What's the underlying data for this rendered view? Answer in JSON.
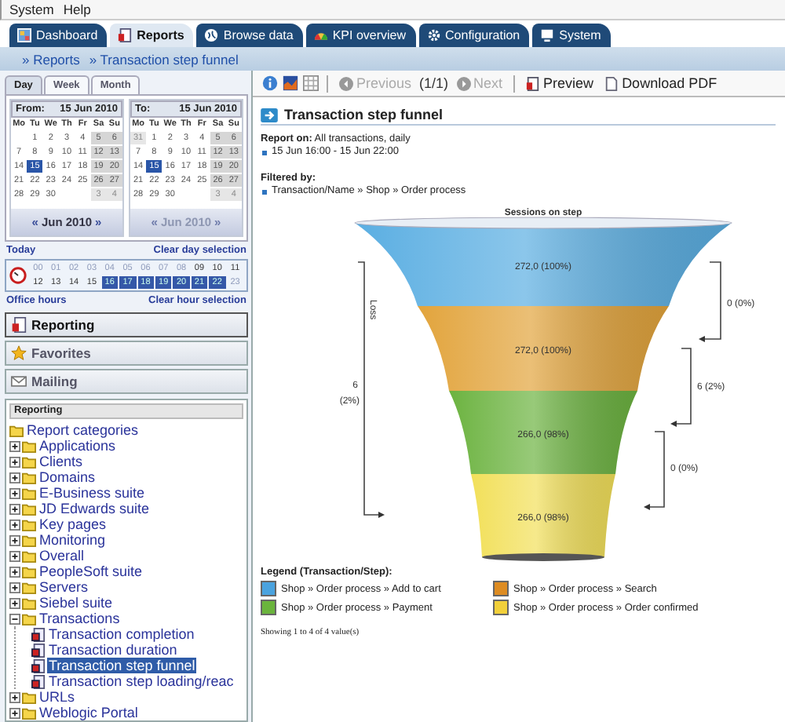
{
  "menu": [
    "System",
    "Help"
  ],
  "tabs": [
    {
      "label": "Dashboard",
      "selected": false
    },
    {
      "label": "Reports",
      "selected": true
    },
    {
      "label": "Browse data",
      "selected": false
    },
    {
      "label": "KPI overview",
      "selected": false
    },
    {
      "label": "Configuration",
      "selected": false
    },
    {
      "label": "System",
      "selected": false
    }
  ],
  "breadcrumb": [
    "» Reports",
    "» Transaction step funnel"
  ],
  "period_tabs": [
    {
      "label": "Day",
      "selected": true
    },
    {
      "label": "Week",
      "selected": false
    },
    {
      "label": "Month",
      "selected": false
    }
  ],
  "calendars": [
    {
      "label": "From:",
      "date": "15 Jun 2010",
      "weekdays": [
        "Mo",
        "Tu",
        "We",
        "Th",
        "Fr",
        "Sa",
        "Su"
      ],
      "nav_prev": "«",
      "nav_label": "Jun 2010",
      "nav_next": "»",
      "nav_disabled": false,
      "weeks": [
        [
          {
            "kind": "blank"
          },
          {
            "label": "1",
            "kind": "day",
            "selected": false
          },
          {
            "label": "2",
            "kind": "day",
            "selected": false
          },
          {
            "label": "3",
            "kind": "day",
            "selected": false
          },
          {
            "label": "4",
            "kind": "day",
            "selected": false
          },
          {
            "label": "5",
            "kind": "weekend",
            "selected": false
          },
          {
            "label": "6",
            "kind": "weekend",
            "selected": false
          }
        ],
        [
          {
            "label": "7",
            "kind": "day",
            "selected": false
          },
          {
            "label": "8",
            "kind": "day",
            "selected": false
          },
          {
            "label": "9",
            "kind": "day",
            "selected": false
          },
          {
            "label": "10",
            "kind": "day",
            "selected": false
          },
          {
            "label": "11",
            "kind": "day",
            "selected": false
          },
          {
            "label": "12",
            "kind": "weekend",
            "selected": false
          },
          {
            "label": "13",
            "kind": "weekend",
            "selected": false
          }
        ],
        [
          {
            "label": "14",
            "kind": "day",
            "selected": false
          },
          {
            "label": "15",
            "kind": "day",
            "selected": true
          },
          {
            "label": "16",
            "kind": "day",
            "selected": false
          },
          {
            "label": "17",
            "kind": "day",
            "selected": false
          },
          {
            "label": "18",
            "kind": "day",
            "selected": false
          },
          {
            "label": "19",
            "kind": "weekend",
            "selected": false
          },
          {
            "label": "20",
            "kind": "weekend",
            "selected": false
          }
        ],
        [
          {
            "label": "21",
            "kind": "day",
            "selected": false
          },
          {
            "label": "22",
            "kind": "day",
            "selected": false
          },
          {
            "label": "23",
            "kind": "day",
            "selected": false
          },
          {
            "label": "24",
            "kind": "day",
            "selected": false
          },
          {
            "label": "25",
            "kind": "day",
            "selected": false
          },
          {
            "label": "26",
            "kind": "weekend",
            "selected": false
          },
          {
            "label": "27",
            "kind": "weekend",
            "selected": false
          }
        ],
        [
          {
            "label": "28",
            "kind": "day",
            "selected": false
          },
          {
            "label": "29",
            "kind": "day",
            "selected": false
          },
          {
            "label": "30",
            "kind": "day",
            "selected": false
          },
          {
            "kind": "blank"
          },
          {
            "kind": "blank"
          },
          {
            "label": "3",
            "kind": "other",
            "selected": false
          },
          {
            "label": "4",
            "kind": "other",
            "selected": false
          }
        ]
      ]
    },
    {
      "label": "To:",
      "date": "15 Jun 2010",
      "weekdays": [
        "Mo",
        "Tu",
        "We",
        "Th",
        "Fr",
        "Sa",
        "Su"
      ],
      "nav_prev": "«",
      "nav_label": "Jun 2010",
      "nav_next": "»",
      "nav_disabled": true,
      "weeks": [
        [
          {
            "label": "31",
            "kind": "other",
            "selected": false
          },
          {
            "label": "1",
            "kind": "day",
            "selected": false
          },
          {
            "label": "2",
            "kind": "day",
            "selected": false
          },
          {
            "label": "3",
            "kind": "day",
            "selected": false
          },
          {
            "label": "4",
            "kind": "day",
            "selected": false
          },
          {
            "label": "5",
            "kind": "weekend",
            "selected": false
          },
          {
            "label": "6",
            "kind": "weekend",
            "selected": false
          }
        ],
        [
          {
            "label": "7",
            "kind": "day",
            "selected": false
          },
          {
            "label": "8",
            "kind": "day",
            "selected": false
          },
          {
            "label": "9",
            "kind": "day",
            "selected": false
          },
          {
            "label": "10",
            "kind": "day",
            "selected": false
          },
          {
            "label": "11",
            "kind": "day",
            "selected": false
          },
          {
            "label": "12",
            "kind": "weekend",
            "selected": false
          },
          {
            "label": "13",
            "kind": "weekend",
            "selected": false
          }
        ],
        [
          {
            "label": "14",
            "kind": "day",
            "selected": false
          },
          {
            "label": "15",
            "kind": "day",
            "selected": true
          },
          {
            "label": "16",
            "kind": "day",
            "selected": false
          },
          {
            "label": "17",
            "kind": "day",
            "selected": false
          },
          {
            "label": "18",
            "kind": "day",
            "selected": false
          },
          {
            "label": "19",
            "kind": "weekend",
            "selected": false
          },
          {
            "label": "20",
            "kind": "weekend",
            "selected": false
          }
        ],
        [
          {
            "label": "21",
            "kind": "day",
            "selected": false
          },
          {
            "label": "22",
            "kind": "day",
            "selected": false
          },
          {
            "label": "23",
            "kind": "day",
            "selected": false
          },
          {
            "label": "24",
            "kind": "day",
            "selected": false
          },
          {
            "label": "25",
            "kind": "day",
            "selected": false
          },
          {
            "label": "26",
            "kind": "weekend",
            "selected": false
          },
          {
            "label": "27",
            "kind": "weekend",
            "selected": false
          }
        ],
        [
          {
            "label": "28",
            "kind": "day",
            "selected": false
          },
          {
            "label": "29",
            "kind": "day",
            "selected": false
          },
          {
            "label": "30",
            "kind": "day",
            "selected": false
          },
          {
            "kind": "blank"
          },
          {
            "kind": "blank"
          },
          {
            "label": "3",
            "kind": "other",
            "selected": false
          },
          {
            "label": "4",
            "kind": "other",
            "selected": false
          }
        ]
      ]
    }
  ],
  "day_links": [
    "Today",
    "Clear day selection"
  ],
  "hours": [
    [
      {
        "label": "00",
        "disabled": true,
        "selected": false
      },
      {
        "label": "01",
        "disabled": true,
        "selected": false
      },
      {
        "label": "02",
        "disabled": true,
        "selected": false
      },
      {
        "label": "03",
        "disabled": true,
        "selected": false
      },
      {
        "label": "04",
        "disabled": true,
        "selected": false
      },
      {
        "label": "05",
        "disabled": true,
        "selected": false
      },
      {
        "label": "06",
        "disabled": true,
        "selected": false
      },
      {
        "label": "07",
        "disabled": true,
        "selected": false
      },
      {
        "label": "08",
        "disabled": true,
        "selected": false
      },
      {
        "label": "09",
        "disabled": false,
        "selected": false
      },
      {
        "label": "10",
        "disabled": false,
        "selected": false
      },
      {
        "label": "11",
        "disabled": false,
        "selected": false
      }
    ],
    [
      {
        "label": "12",
        "disabled": false,
        "selected": false
      },
      {
        "label": "13",
        "disabled": false,
        "selected": false
      },
      {
        "label": "14",
        "disabled": false,
        "selected": false
      },
      {
        "label": "15",
        "disabled": false,
        "selected": false
      },
      {
        "label": "16",
        "disabled": false,
        "selected": true
      },
      {
        "label": "17",
        "disabled": false,
        "selected": true
      },
      {
        "label": "18",
        "disabled": false,
        "selected": true
      },
      {
        "label": "19",
        "disabled": false,
        "selected": true
      },
      {
        "label": "20",
        "disabled": false,
        "selected": true
      },
      {
        "label": "21",
        "disabled": false,
        "selected": true
      },
      {
        "label": "22",
        "disabled": false,
        "selected": true
      },
      {
        "label": "23",
        "disabled": true,
        "selected": false
      }
    ]
  ],
  "hour_links": [
    "Office hours",
    "Clear hour selection"
  ],
  "sections": [
    {
      "label": "Reporting",
      "selected": true
    },
    {
      "label": "Favorites",
      "selected": false
    },
    {
      "label": "Mailing",
      "selected": false
    }
  ],
  "tree": {
    "header": "Reporting",
    "nodes": [
      {
        "label": "Report categories",
        "kind": "root",
        "selected": false,
        "children": [
          {
            "label": "Applications",
            "kind": "folder",
            "expanded": false,
            "selected": false
          },
          {
            "label": "Clients",
            "kind": "folder",
            "expanded": false,
            "selected": false
          },
          {
            "label": "Domains",
            "kind": "folder",
            "expanded": false,
            "selected": false
          },
          {
            "label": "E-Business suite",
            "kind": "folder",
            "expanded": false,
            "selected": false
          },
          {
            "label": "JD Edwards suite",
            "kind": "folder",
            "expanded": false,
            "selected": false
          },
          {
            "label": "Key pages",
            "kind": "folder",
            "expanded": false,
            "selected": false
          },
          {
            "label": "Monitoring",
            "kind": "folder",
            "expanded": false,
            "selected": false
          },
          {
            "label": "Overall",
            "kind": "folder",
            "expanded": false,
            "selected": false
          },
          {
            "label": "PeopleSoft suite",
            "kind": "folder",
            "expanded": false,
            "selected": false
          },
          {
            "label": "Servers",
            "kind": "folder",
            "expanded": false,
            "selected": false
          },
          {
            "label": "Siebel suite",
            "kind": "folder",
            "expanded": false,
            "selected": false
          },
          {
            "label": "Transactions",
            "kind": "folder",
            "expanded": true,
            "selected": false,
            "children": [
              {
                "label": "Transaction completion",
                "kind": "report",
                "selected": false
              },
              {
                "label": "Transaction duration",
                "kind": "report",
                "selected": false
              },
              {
                "label": "Transaction step funnel",
                "kind": "report",
                "selected": true
              },
              {
                "label": "Transaction step loading/reac",
                "kind": "report",
                "selected": false
              }
            ]
          },
          {
            "label": "URLs",
            "kind": "folder",
            "expanded": false,
            "selected": false
          },
          {
            "label": "Weblogic Portal",
            "kind": "folder",
            "expanded": false,
            "selected": false
          }
        ]
      }
    ]
  },
  "toolbar": {
    "previous": {
      "label": "Previous",
      "disabled": true
    },
    "page": "(1/1)",
    "next": {
      "label": "Next",
      "disabled": true
    },
    "preview": "Preview",
    "download": "Download PDF"
  },
  "report": {
    "title": "Transaction step funnel",
    "report_on": "**Report on:** All transactions, daily",
    "period": "15 Jun 16:00 - 15 Jun 22:00",
    "filter_heading": "Filtered by:",
    "filter": "Transaction/Name » Shop » Order process"
  },
  "funnel": {
    "title": "Sessions on step",
    "steps": [
      {
        "value": "272,0 (100%)",
        "color": "#5aaee2"
      },
      {
        "value": "272,0 (100%)",
        "color": "#e2a43c"
      },
      {
        "value": "266,0 (98%)",
        "color": "#6cb340"
      },
      {
        "value": "266,0 (98%)",
        "color": "#f2e05a"
      }
    ],
    "step_losses": [
      "0 (0%)",
      "6 (2%)",
      "0 (0%)"
    ],
    "total_loss": {
      "axis_label": "Loss",
      "value": "6",
      "share": "(2%)"
    }
  },
  "legend": {
    "title": "Legend (Transaction/Step):",
    "items": [
      {
        "label": "Shop » Order process » Add to cart",
        "color": "#4aa3df"
      },
      {
        "label": "Shop » Order process » Search",
        "color": "#de8c22"
      },
      {
        "label": "Shop » Order process » Payment",
        "color": "#6ab43c"
      },
      {
        "label": "Shop » Order process » Order confirmed",
        "color": "#f2d03a"
      }
    ]
  },
  "footer": "Showing 1 to 4 of 4 value(s)"
}
